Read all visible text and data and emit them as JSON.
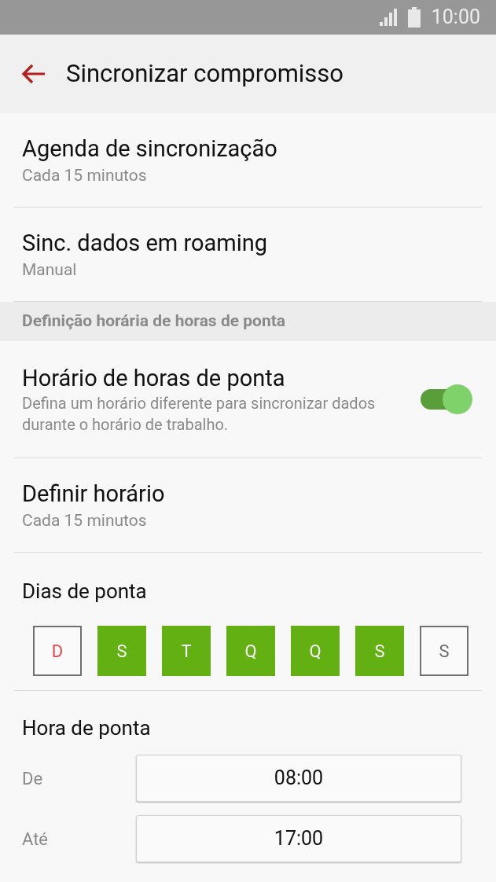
{
  "status_bar": {
    "time": "10:00"
  },
  "header": {
    "title": "Sincronizar compromisso"
  },
  "settings": [
    {
      "title": "Agenda de sincronização",
      "summary": "Cada 15 minutos"
    },
    {
      "title": "Sinc. dados em roaming",
      "summary": "Manual"
    }
  ],
  "section": {
    "title": "Definição horária de horas de ponta"
  },
  "peak_toggle": {
    "title": "Horário de horas de ponta",
    "summary": "Defina um horário diferente para sincronizar dados durante o horário de trabalho.",
    "on": true
  },
  "schedule": {
    "title": "Definir horário",
    "summary": "Cada 15 minutos"
  },
  "peak_days": {
    "title": "Dias de ponta",
    "days": [
      {
        "label": "D",
        "selected": false,
        "color": "#e5484d"
      },
      {
        "label": "S",
        "selected": true
      },
      {
        "label": "T",
        "selected": true
      },
      {
        "label": "Q",
        "selected": true
      },
      {
        "label": "Q",
        "selected": true
      },
      {
        "label": "S",
        "selected": true
      },
      {
        "label": "S",
        "selected": false,
        "color": "#6b6b6b"
      }
    ]
  },
  "peak_hours": {
    "title": "Hora de ponta",
    "rows": [
      {
        "label": "De",
        "value": "08:00"
      },
      {
        "label": "Até",
        "value": "17:00"
      }
    ]
  }
}
